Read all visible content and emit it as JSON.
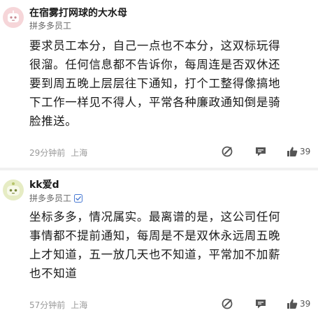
{
  "comments": [
    {
      "username": "在宿雾打网球的大水母",
      "role": "拼多多员工",
      "verified": false,
      "lines": [
        "要求员工本分，自己一点也不本分，这双标玩得",
        "很溜。任何信息都不告诉你，每周连是否双休还",
        "要到周五晚上层层往下通知，打个工整得像搞地",
        "下工作一样见不得人，平常各种廉政通知倒是骑",
        "脸推送。"
      ],
      "time": "29分钟前",
      "location": "上海",
      "likes": "39",
      "avatar_color": "#f6d6d9",
      "avatar_icon": "robot-face"
    },
    {
      "username": "kk爱d",
      "role": "拼多多员工",
      "verified": true,
      "lines": [
        "坐标多多，情况属实。最离谱的是，这公司任何",
        "事情都不提前通知，每周是不是双休永远周五晚",
        "上才知道，五一放几天也不知道，平常加不加薪",
        "也不知道"
      ],
      "time": "57分钟前",
      "location": "上海",
      "likes": "39",
      "avatar_color": "#e6ecc4",
      "avatar_icon": "robot-face"
    }
  ],
  "colors": {
    "divider": "#f1f1f1",
    "meta_text": "#9a9a9a",
    "icon": "#555555",
    "verified": "#4a7bd4"
  }
}
